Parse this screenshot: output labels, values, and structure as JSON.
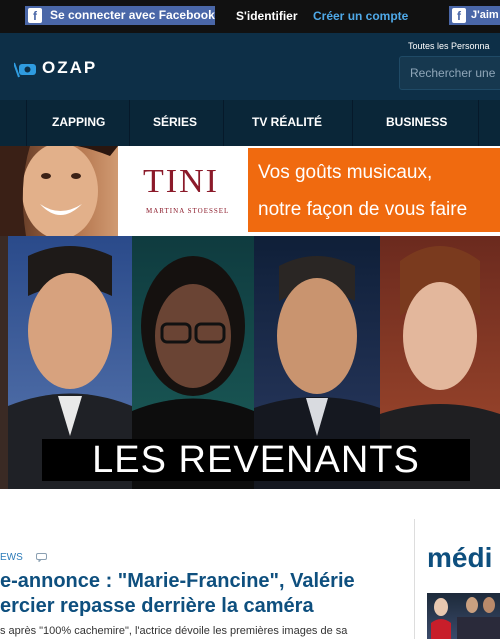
{
  "topbar": {
    "facebook_connect": "Se connecter avec Facebook",
    "signin": "S'identifier",
    "create_account": "Créer un compte",
    "like": "J'aim"
  },
  "header": {
    "logo": "OZAP",
    "personal_link": "Toutes les Personna",
    "search_placeholder": "Rechercher une"
  },
  "nav": {
    "items": [
      "ZAPPING",
      "SÉRIES",
      "TV RÉALITÉ",
      "BUSINESS"
    ]
  },
  "ad": {
    "brand": "TINI",
    "brand_sub": "MARTINA STOESSEL",
    "line1": "Vos goûts musicaux,",
    "line2": "notre façon de vous faire"
  },
  "hero": {
    "title": "LES REVENANTS"
  },
  "article": {
    "category": "EWS",
    "headline_line1": "e-annonce : \"Marie-Francine\", Valérie",
    "headline_line2": "ercier repasse derrière la caméra",
    "summary": "s après \"100% cachemire\", l'actrice dévoile les premières images de sa"
  },
  "sidebar": {
    "title": "médi"
  },
  "colors": {
    "header_bg": "#0d2f47",
    "nav_bg": "#0a2638",
    "accent_orange": "#f06a0f",
    "headline_blue": "#0e4f7e",
    "facebook_blue": "#4a67a8"
  }
}
